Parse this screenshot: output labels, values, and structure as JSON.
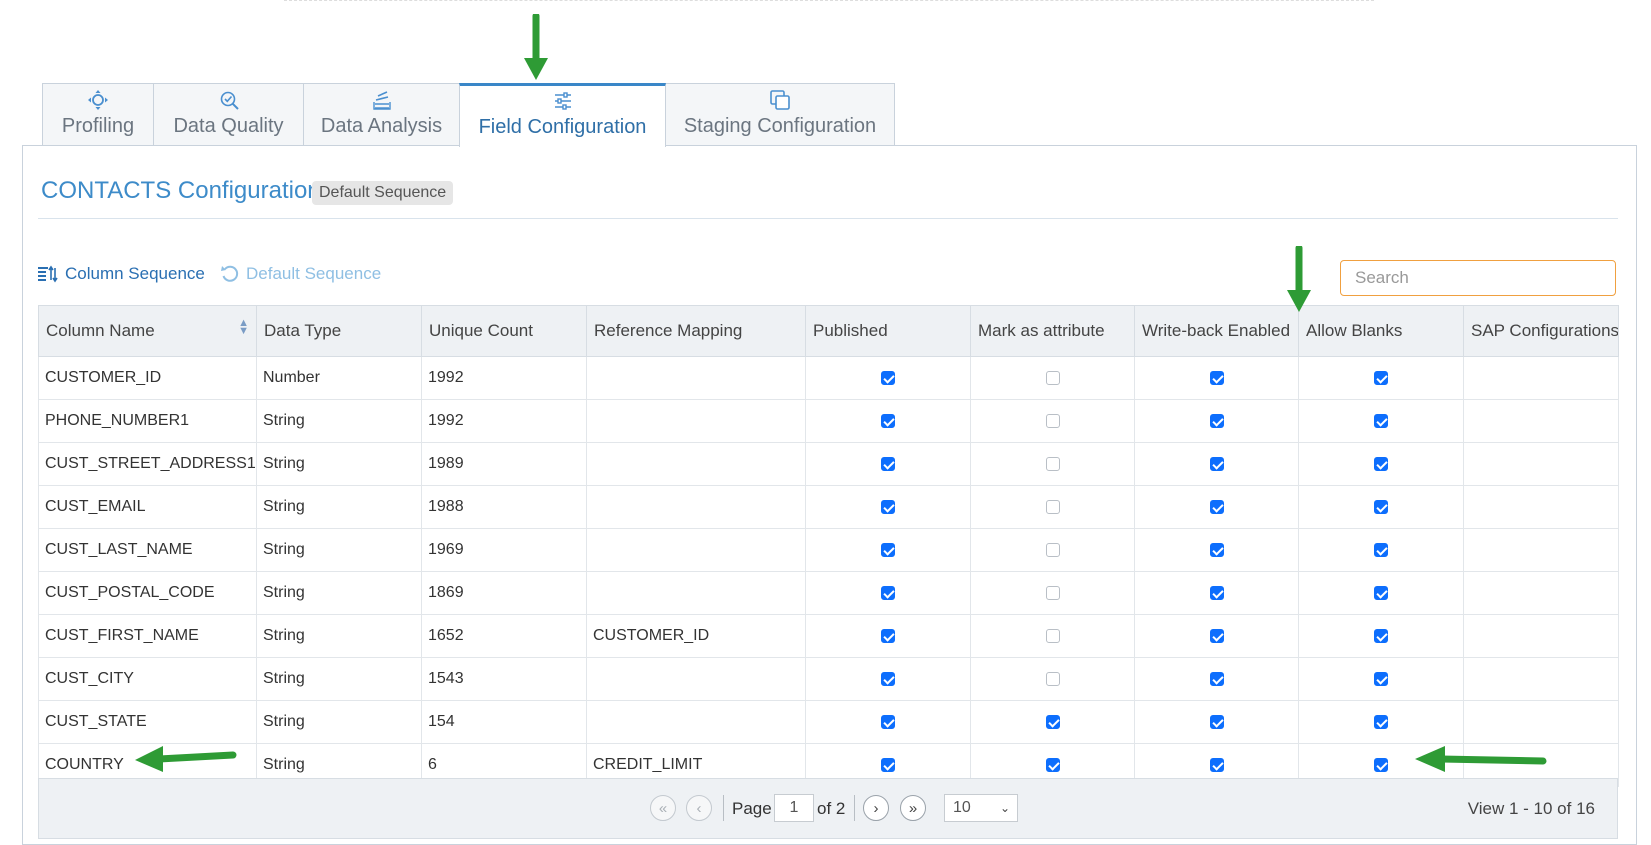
{
  "tabs": [
    {
      "label": "Profiling",
      "icon": "crosshair-icon",
      "active": false
    },
    {
      "label": "Data Quality",
      "icon": "magnifier-check-icon",
      "active": false
    },
    {
      "label": "Data Analysis",
      "icon": "stack-icon",
      "active": false
    },
    {
      "label": "Field Configuration",
      "icon": "sliders-icon",
      "active": true
    },
    {
      "label": "Staging Configuration",
      "icon": "copy-icon",
      "active": false
    }
  ],
  "header": {
    "title": "CONTACTS Configuration",
    "badge": "Default Sequence"
  },
  "toolbar": {
    "column_sequence": "Column Sequence",
    "default_sequence": "Default Sequence",
    "search_placeholder": "Search"
  },
  "table": {
    "columns": [
      "Column Name",
      "Data Type",
      "Unique Count",
      "Reference Mapping",
      "Published",
      "Mark as attribute",
      "Write-back Enabled",
      "Allow Blanks",
      "SAP Configurations"
    ],
    "rows": [
      {
        "name": "CUSTOMER_ID",
        "type": "Number",
        "unique": "1992",
        "ref": "",
        "published": true,
        "attribute": false,
        "writeback": true,
        "blanks": true,
        "sap": ""
      },
      {
        "name": "PHONE_NUMBER1",
        "type": "String",
        "unique": "1992",
        "ref": "",
        "published": true,
        "attribute": false,
        "writeback": true,
        "blanks": true,
        "sap": ""
      },
      {
        "name": "CUST_STREET_ADDRESS1",
        "type": "String",
        "unique": "1989",
        "ref": "",
        "published": true,
        "attribute": false,
        "writeback": true,
        "blanks": true,
        "sap": ""
      },
      {
        "name": "CUST_EMAIL",
        "type": "String",
        "unique": "1988",
        "ref": "",
        "published": true,
        "attribute": false,
        "writeback": true,
        "blanks": true,
        "sap": ""
      },
      {
        "name": "CUST_LAST_NAME",
        "type": "String",
        "unique": "1969",
        "ref": "",
        "published": true,
        "attribute": false,
        "writeback": true,
        "blanks": true,
        "sap": ""
      },
      {
        "name": "CUST_POSTAL_CODE",
        "type": "String",
        "unique": "1869",
        "ref": "",
        "published": true,
        "attribute": false,
        "writeback": true,
        "blanks": true,
        "sap": ""
      },
      {
        "name": "CUST_FIRST_NAME",
        "type": "String",
        "unique": "1652",
        "ref": "CUSTOMER_ID",
        "published": true,
        "attribute": false,
        "writeback": true,
        "blanks": true,
        "sap": ""
      },
      {
        "name": "CUST_CITY",
        "type": "String",
        "unique": "1543",
        "ref": "",
        "published": true,
        "attribute": false,
        "writeback": true,
        "blanks": true,
        "sap": ""
      },
      {
        "name": "CUST_STATE",
        "type": "String",
        "unique": "154",
        "ref": "",
        "published": true,
        "attribute": true,
        "writeback": true,
        "blanks": true,
        "sap": ""
      },
      {
        "name": "COUNTRY",
        "type": "String",
        "unique": "6",
        "ref": "CREDIT_LIMIT",
        "published": true,
        "attribute": true,
        "writeback": true,
        "blanks": true,
        "sap": ""
      }
    ]
  },
  "pager": {
    "page_label": "Page",
    "page": "1",
    "of_label": "of 2",
    "page_size": "10",
    "view": "View 1 - 10 of 16"
  },
  "colors": {
    "accent": "#3d8bc9",
    "checkbox": "#0d6efd",
    "annotation_arrow": "#2e9b35",
    "search_border": "#f0a040"
  }
}
